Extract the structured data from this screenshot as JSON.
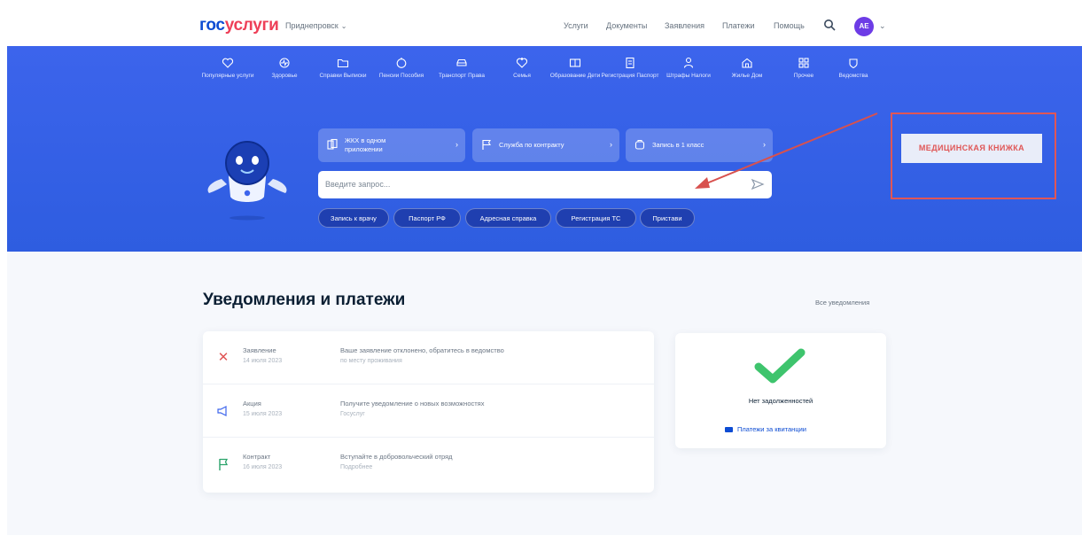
{
  "header": {
    "logo": {
      "part1": "гос",
      "part2": "услуги"
    },
    "region": "Приднепровск",
    "nav": [
      "Услуги",
      "Документы",
      "Заявления",
      "Платежи",
      "Помощь"
    ],
    "avatar_initials": "АЕ"
  },
  "categories": [
    {
      "label": "Популярные услуги",
      "icon": "heart-icon"
    },
    {
      "label": "Здоровье",
      "icon": "pulse-icon"
    },
    {
      "label": "Справки Выписки",
      "icon": "folder-icon"
    },
    {
      "label": "Пенсии Пособия",
      "icon": "wallet-icon"
    },
    {
      "label": "Транспорт Права",
      "icon": "car-icon"
    },
    {
      "label": "Семья",
      "icon": "family-icon"
    },
    {
      "label": "Образование Дети",
      "icon": "book-icon"
    },
    {
      "label": "Регистрация Паспорт",
      "icon": "passport-icon"
    },
    {
      "label": "Штрафы Налоги",
      "icon": "fine-icon"
    },
    {
      "label": "Жилье Дом",
      "icon": "house-icon"
    },
    {
      "label": "Прочее",
      "icon": "grid-icon"
    },
    {
      "label": "Ведомства",
      "icon": "emblem-icon"
    }
  ],
  "quick_cards": [
    {
      "label_1": "ЖКХ в одном",
      "label_2": "приложении"
    },
    {
      "label_1": "Служба по контракту",
      "label_2": ""
    },
    {
      "label_1": "Запись в 1 класс",
      "label_2": ""
    }
  ],
  "search": {
    "placeholder": "Введите запрос..."
  },
  "chips": [
    "Запись к врачу",
    "Паспорт РФ",
    "Адресная справка",
    "Регистрация ТС",
    "Пристави"
  ],
  "annotation": {
    "label": "МЕДИЦИНСКАЯ КНИЖКА",
    "color": "#e05656"
  },
  "notifications": {
    "title": "Уведомления и платежи",
    "all_link": "Все уведомления",
    "items": [
      {
        "icon": "cross-icon",
        "title": "Заявление",
        "date": "14 июля 2023",
        "text": "Ваше заявление отклонено, обратитесь в ведомство",
        "sub": "по месту проживания"
      },
      {
        "icon": "megaphone-icon",
        "title": "Акция",
        "date": "15 июля 2023",
        "text": "Получите уведомление о новых возможностях",
        "sub": "Госуслуг"
      },
      {
        "icon": "flag-icon",
        "title": "Контракт",
        "date": "16 июля 2023",
        "text": "Вступайте в добровольческий отряд",
        "sub": "Подробнее"
      }
    ]
  },
  "payments": {
    "status": "Нет задолженностей",
    "link": "Платежи за квитанции"
  },
  "colors": {
    "brand_blue": "#0d4cd3",
    "brand_red": "#ee3f58",
    "banner": "#3c64ec",
    "check_green": "#3ec46d"
  }
}
